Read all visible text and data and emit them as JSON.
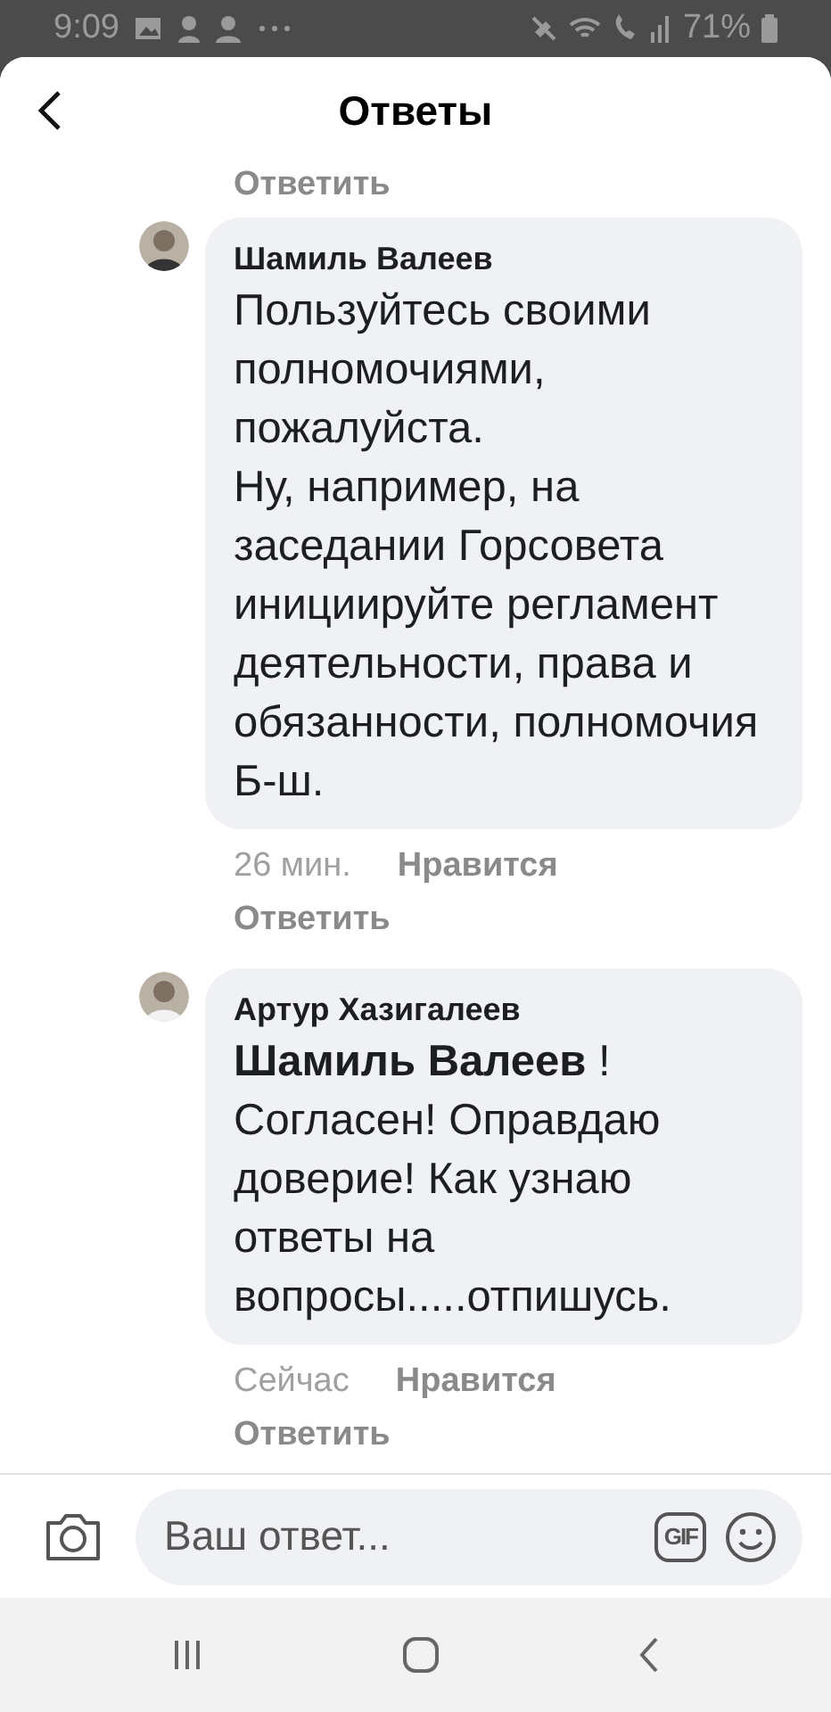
{
  "status_bar": {
    "time": "9:09",
    "battery": "71%"
  },
  "header": {
    "title": "Ответы"
  },
  "top_reply_link": "Ответить",
  "comments": [
    {
      "author": "Шамиль Валеев",
      "text": "Пользуйтесь своими полномочиями, пожалуйста.\nНу, например, на заседании Горсовета инициируйте регламент деятельности, права и обязанности, полномочия Б-ш.",
      "time": "26 мин.",
      "like": "Нравится",
      "reply": "Ответить"
    },
    {
      "author": "Артур Хазигалеев",
      "text": "**Шамиль Валеев** !\nСогласен! Оправдаю доверие! Как узнаю ответы на вопросы.....отпишусь.",
      "time": "Сейчас",
      "like": "Нравится",
      "reply": "Ответить"
    }
  ],
  "composer": {
    "placeholder": "Ваш ответ...",
    "gif": "GIF"
  }
}
